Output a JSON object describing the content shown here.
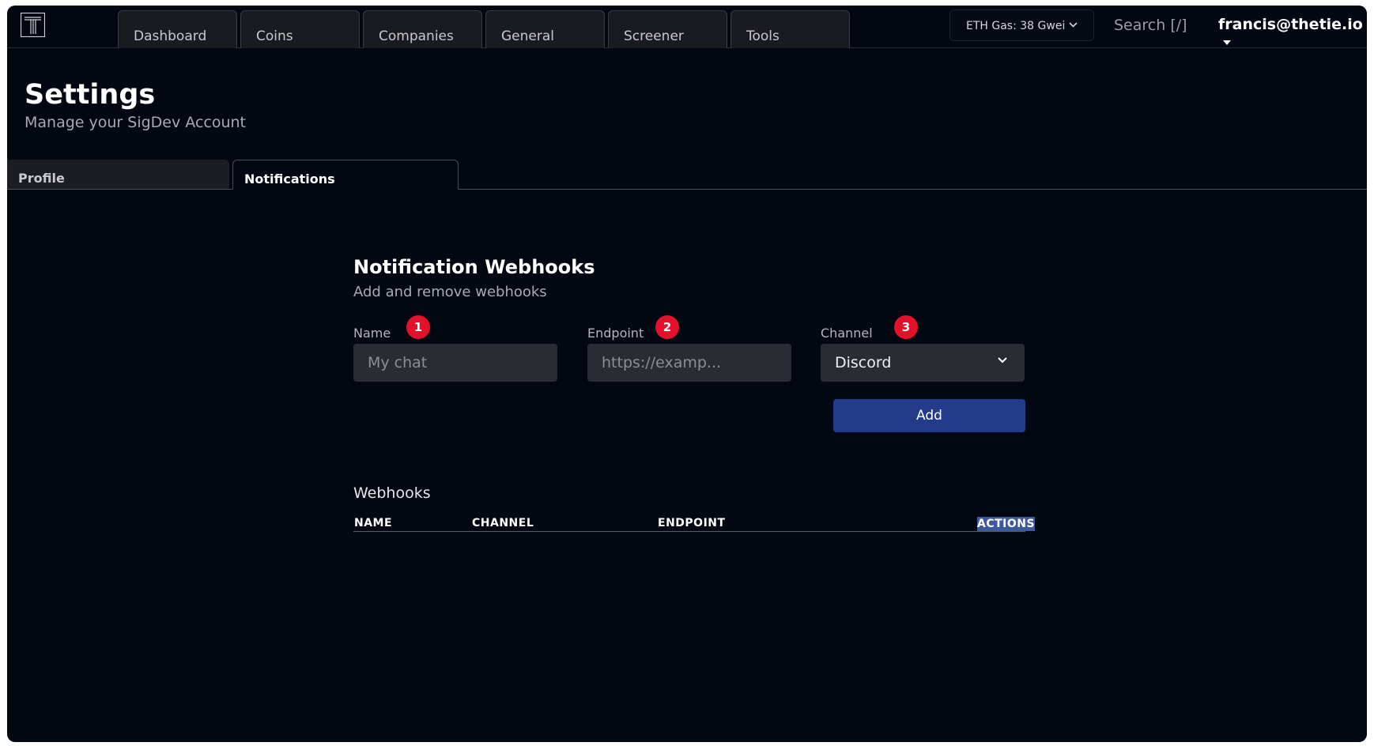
{
  "nav": {
    "tabs": [
      {
        "label": "Dashboard"
      },
      {
        "label": "Coins"
      },
      {
        "label": "Companies"
      },
      {
        "label": "General"
      },
      {
        "label": "Screener"
      },
      {
        "label": "Tools"
      }
    ],
    "gas_label": "ETH Gas: 38 Gwei",
    "search_label": "Search [/]",
    "user_email": "francis@thetie.io"
  },
  "header": {
    "title": "Settings",
    "subtitle": "Manage your SigDev Account"
  },
  "settings_tabs": [
    {
      "label": "Profile",
      "active": false
    },
    {
      "label": "Notifications",
      "active": true
    }
  ],
  "webhooks_form": {
    "title": "Notification Webhooks",
    "subtitle": "Add and remove webhooks",
    "name_label": "Name",
    "name_placeholder": "My chat",
    "endpoint_label": "Endpoint",
    "endpoint_placeholder": "https://examp...",
    "channel_label": "Channel",
    "channel_value": "Discord",
    "add_label": "Add",
    "badges": [
      "1",
      "2",
      "3"
    ]
  },
  "webhooks_table": {
    "label": "Webhooks",
    "columns": [
      "NAME",
      "CHANNEL",
      "ENDPOINT",
      "ACTIONS"
    ]
  },
  "colors": {
    "background": "#030712",
    "accent_button": "#243a8a",
    "badge": "#e3122a",
    "highlight": "#3b5aa0"
  }
}
